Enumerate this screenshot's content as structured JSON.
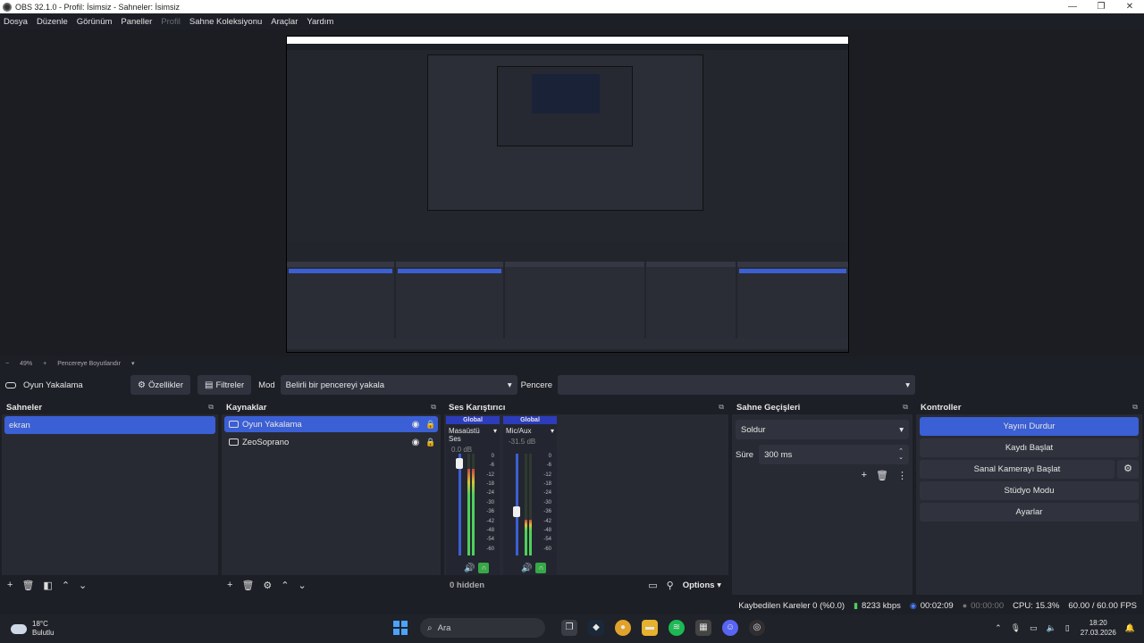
{
  "window": {
    "title": "OBS 32.1.0 - Profil: İsimsiz - Sahneler: İsimsiz"
  },
  "menu": [
    "Dosya",
    "Düzenle",
    "Görünüm",
    "Paneller",
    "Profil",
    "Sahne Koleksiyonu",
    "Araçlar",
    "Yardım"
  ],
  "preview_controls": {
    "zoom_minus": "−",
    "zoom": "49%",
    "zoom_plus": "+",
    "resize": "Pencereye Boyutlandır"
  },
  "context": {
    "source": "Oyun Yakalama",
    "properties": "Özellikler",
    "filters": "Filtreler",
    "mode_label": "Mod",
    "mode_value": "Belirli bir pencereyi yakala",
    "window_label": "Pencere",
    "window_value": ""
  },
  "scenes": {
    "title": "Sahneler",
    "items": [
      "ekran"
    ]
  },
  "sources": {
    "title": "Kaynaklar",
    "items": [
      {
        "name": "Oyun Yakalama"
      },
      {
        "name": "ZeoSoprano"
      }
    ]
  },
  "mixer": {
    "title": "Ses Karıştırıcı",
    "channels": [
      {
        "global": "Global",
        "name": "Masaüstü Ses",
        "db": "0.0 dB",
        "level": 0.85,
        "fader": 0.95
      },
      {
        "global": "Global",
        "name": "Mic/Aux",
        "db": "-31.5 dB",
        "level": 0.35,
        "fader": 0.42
      }
    ],
    "scale": [
      "0",
      "-6",
      "-12",
      "-18",
      "-24",
      "-30",
      "-36",
      "-42",
      "-48",
      "-54",
      "-60"
    ],
    "hidden": "0 hidden",
    "options": "Options"
  },
  "transitions": {
    "title": "Sahne Geçişleri",
    "selected": "Soldur",
    "duration_label": "Süre",
    "duration_value": "300 ms"
  },
  "controls": {
    "title": "Kontroller",
    "stop_stream": "Yayını Durdur",
    "start_record": "Kaydı Başlat",
    "virtual_cam": "Sanal Kamerayı Başlat",
    "studio_mode": "Stüdyo Modu",
    "settings": "Ayarlar"
  },
  "status": {
    "dropped": "Kaybedilen Kareler 0 (%0.0)",
    "bitrate": "8233 kbps",
    "stream_time": "00:02:09",
    "record_time": "00:00:00",
    "cpu": "CPU: 15.3%",
    "fps": "60.00 / 60.00 FPS"
  },
  "taskbar": {
    "temp": "18°C",
    "weather": "Bulutlu",
    "search": "Ara",
    "time": "18:20",
    "date": "27.03.2026"
  }
}
